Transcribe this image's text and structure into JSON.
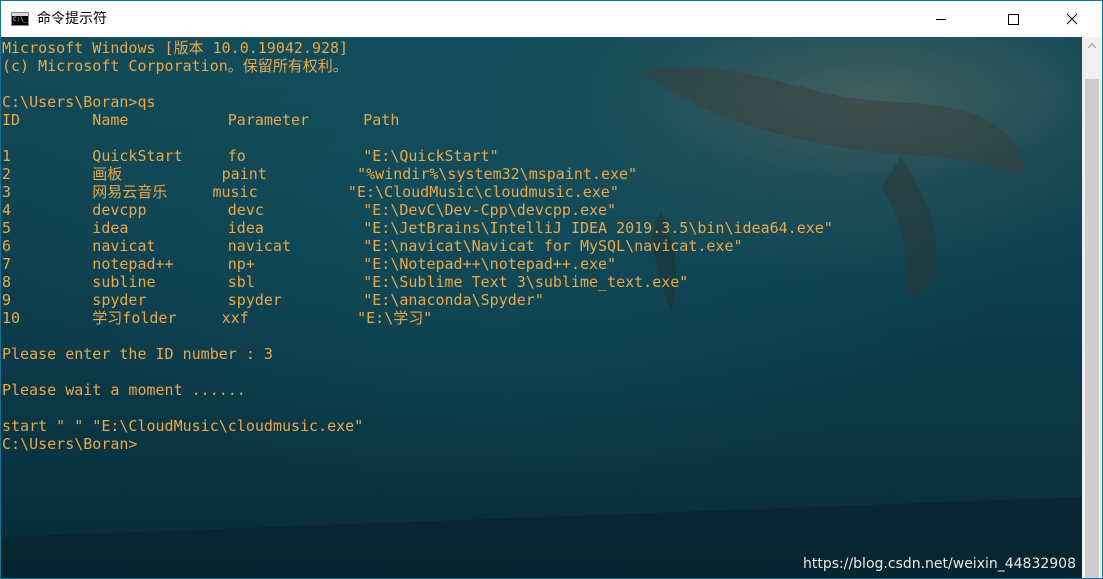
{
  "window": {
    "title": "命令提示符",
    "icon": "cmd-icon",
    "controls": [
      "minimize-icon",
      "maximize-icon",
      "close-icon"
    ]
  },
  "console": {
    "text_color": "#e9a84b",
    "lines": [
      "Microsoft Windows [版本 10.0.19042.928]",
      "(c) Microsoft Corporation。保留所有权利。",
      "",
      "C:\\Users\\Boran>qs",
      "ID        Name           Parameter      Path",
      "",
      "1         QuickStart     fo             \"E:\\QuickStart\"",
      "2         画板           paint          \"%windir%\\system32\\mspaint.exe\"",
      "3         网易云音乐     music          \"E:\\CloudMusic\\cloudmusic.exe\"",
      "4         devcpp         devc           \"E:\\DevC\\Dev-Cpp\\devcpp.exe\"",
      "5         idea           idea           \"E:\\JetBrains\\IntelliJ IDEA 2019.3.5\\bin\\idea64.exe\"",
      "6         navicat        navicat        \"E:\\navicat\\Navicat for MySQL\\navicat.exe\"",
      "7         notepad++      np+            \"E:\\Notepad++\\notepad++.exe\"",
      "8         subline        sbl            \"E:\\Sublime Text 3\\sublime_text.exe\"",
      "9         spyder         spyder         \"E:\\anaconda\\Spyder\"",
      "10        学习folder     xxf            \"E:\\学习\"",
      "",
      "Please enter the ID number : 3",
      "",
      "Please wait a moment ......",
      "",
      "start \" \" \"E:\\CloudMusic\\cloudmusic.exe\"",
      "C:\\Users\\Boran>"
    ]
  },
  "watermark": "https://blog.csdn.net/weixin_44832908"
}
